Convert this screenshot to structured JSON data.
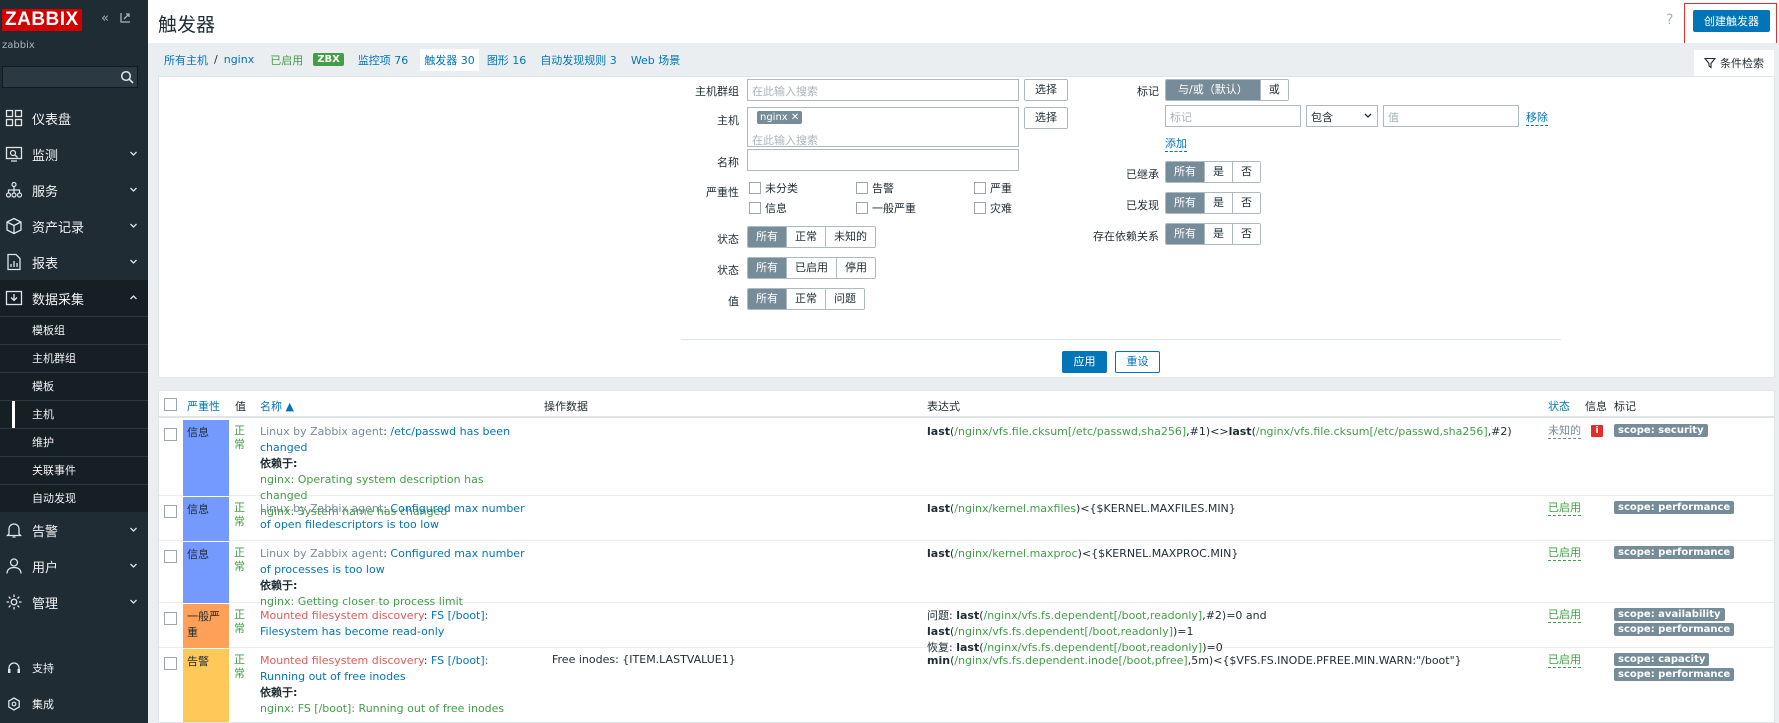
{
  "brand": {
    "logo_text": "ZABBIX",
    "user": "zabbix"
  },
  "colors": {
    "sidebar_bg": "#1f2c33",
    "accent": "#0275b8",
    "logo": "#d40000",
    "enabled": "#429e47",
    "sev_info": "#7499ff",
    "sev_average": "#ffa059",
    "sev_warning": "#ffc859",
    "tag_bg": "#768d99"
  },
  "sidebar": {
    "items": [
      {
        "label": "仪表盘",
        "icon": "dashboard-icon",
        "has_children": false
      },
      {
        "label": "监测",
        "icon": "monitor-icon",
        "has_children": true
      },
      {
        "label": "服务",
        "icon": "services-icon",
        "has_children": true
      },
      {
        "label": "资产记录",
        "icon": "inventory-icon",
        "has_children": true
      },
      {
        "label": "报表",
        "icon": "reports-icon",
        "has_children": true
      },
      {
        "label": "数据采集",
        "icon": "data-collection-icon",
        "has_children": true,
        "expanded": true
      }
    ],
    "subitems": [
      {
        "label": "模板组"
      },
      {
        "label": "主机群组"
      },
      {
        "label": "模板"
      },
      {
        "label": "主机",
        "selected": true
      },
      {
        "label": "维护"
      },
      {
        "label": "关联事件"
      },
      {
        "label": "自动发现"
      }
    ],
    "items2": [
      {
        "label": "告警",
        "icon": "alerts-icon"
      },
      {
        "label": "用户",
        "icon": "users-icon"
      },
      {
        "label": "管理",
        "icon": "administration-icon"
      }
    ],
    "bottom": [
      {
        "label": "支持",
        "icon": "support-icon"
      },
      {
        "label": "集成",
        "icon": "integrations-icon"
      }
    ]
  },
  "header": {
    "title": "触发器",
    "help": "?",
    "create_button": "创建触发器"
  },
  "navbar": {
    "all_hosts": "所有主机",
    "sep": "/",
    "host": "nginx",
    "enabled": "已启用",
    "zbx": "ZBX",
    "items": "监控项 76",
    "triggers": "触发器 30",
    "graphs": "图形 16",
    "discovery": "自动发现规则 3",
    "web": "Web 场景"
  },
  "filter": {
    "tab_label": "条件检索",
    "host_group_label": "主机群组",
    "search_placeholder": "在此输入搜索",
    "select": "选择",
    "host_label": "主机",
    "host_chip": "nginx",
    "name_label": "名称",
    "severity_label": "严重性",
    "severities": [
      "未分类",
      "告警",
      "严重",
      "信息",
      "一般严重",
      "灾难"
    ],
    "state_label": "状态",
    "state_opts": [
      "所有",
      "正常",
      "未知的"
    ],
    "status_label": "状态",
    "status_opts": [
      "所有",
      "已启用",
      "停用"
    ],
    "value_label": "值",
    "value_opts": [
      "所有",
      "正常",
      "问题"
    ],
    "tags_label": "标记",
    "tags_opts": [
      "与/或（默认）",
      "或"
    ],
    "tag_placeholder": "标记",
    "tag_op": "包含",
    "tag_value_placeholder": "值",
    "remove": "移除",
    "add": "添加",
    "inherited_label": "已继承",
    "discovered_label": "已发现",
    "dependent_label": "存在依赖关系",
    "yesno": [
      "所有",
      "是",
      "否"
    ],
    "apply": "应用",
    "reset": "重设"
  },
  "table": {
    "headers": {
      "severity": "严重性",
      "value": "值",
      "name": "名称 ▲",
      "opdata": "操作数据",
      "expression": "表达式",
      "status": "状态",
      "info": "信息",
      "tags": "标记"
    },
    "dep_label": "依赖于:",
    "rows": [
      {
        "severity": "信息",
        "sev_color": "#7499ff",
        "value": "正常",
        "tpl": "Linux by Zabbix agent",
        "sep": ": ",
        "name": "/etc/passwd has been changed",
        "deps": [
          "nginx: Operating system description has changed",
          "nginx: System name has changed"
        ],
        "opdata": "",
        "expr": [
          {
            "fn": "last",
            "key": "/nginx/vfs.file.cksum[/etc/passwd,sha256]",
            "tail": ",#1)<>"
          },
          {
            "fn": "last",
            "key": "/nginx/vfs.file.cksum[/etc/passwd,sha256]",
            "tail": ",#2)"
          }
        ],
        "status": "未知的",
        "status_unknown": true,
        "info": "i",
        "tags": [
          "scope: security"
        ]
      },
      {
        "severity": "信息",
        "sev_color": "#7499ff",
        "value": "正常",
        "tpl": "Linux by Zabbix agent",
        "sep": ": ",
        "name": "Configured max number of open filedescriptors is too low",
        "deps": [],
        "opdata": "",
        "expr": [
          {
            "fn": "last",
            "key": "/nginx/kernel.maxfiles",
            "tail": ")<{$KERNEL.MAXFILES.MIN}"
          }
        ],
        "status": "已启用",
        "tags": [
          "scope: performance"
        ]
      },
      {
        "severity": "信息",
        "sev_color": "#7499ff",
        "value": "正常",
        "tpl": "Linux by Zabbix agent",
        "sep": ": ",
        "name": "Configured max number of processes is too low",
        "deps": [
          "nginx: Getting closer to process limit"
        ],
        "opdata": "",
        "expr": [
          {
            "fn": "last",
            "key": "/nginx/kernel.maxproc",
            "tail": ")<{$KERNEL.MAXPROC.MIN}"
          }
        ],
        "status": "已启用",
        "tags": [
          "scope: performance"
        ]
      },
      {
        "severity": "一般严重",
        "sev_color": "#ffa059",
        "value": "正常",
        "disc": "Mounted filesystem discovery",
        "sep": ": ",
        "name": "FS [/boot]: Filesystem has become read-only",
        "deps": [],
        "opdata": "",
        "problem_label": "问题: ",
        "recovery_label": "恢复: ",
        "expr_problem": [
          {
            "fn": "last",
            "key": "/nginx/vfs.fs.dependent[/boot,readonly]",
            "tail": ",#2)=0 and "
          },
          {
            "fn": "last",
            "key": "/nginx/vfs.fs.dependent[/boot,readonly]",
            "tail": ")=1"
          }
        ],
        "expr_recovery": [
          {
            "fn": "last",
            "key": "/nginx/vfs.fs.dependent[/boot,readonly]",
            "tail": ")=0"
          }
        ],
        "status": "已启用",
        "tags": [
          "scope: availability",
          "scope: performance"
        ]
      },
      {
        "severity": "告警",
        "sev_color": "#ffc859",
        "value": "正常",
        "disc": "Mounted filesystem discovery",
        "sep": ": ",
        "name": "FS [/boot]: Running out of free inodes",
        "deps": [
          "nginx: FS [/boot]: Running out of free inodes"
        ],
        "opdata": "Free inodes: {ITEM.LASTVALUE1}",
        "expr": [
          {
            "fn": "min",
            "key": "/nginx/vfs.fs.dependent.inode[/boot,pfree]",
            "tail": ",5m)<{$VFS.FS.INODE.PFREE.MIN.WARN:\"/boot\"}"
          }
        ],
        "status": "已启用",
        "tags": [
          "scope: capacity",
          "scope: performance"
        ]
      }
    ]
  }
}
